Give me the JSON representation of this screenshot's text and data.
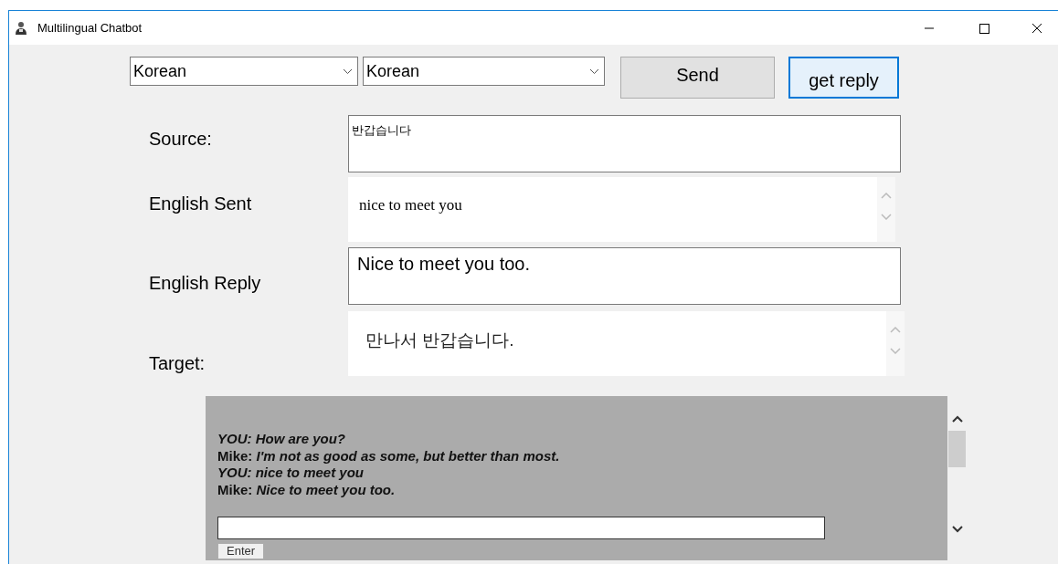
{
  "window": {
    "title": "Multilingual Chatbot"
  },
  "languages": [
    {
      "value": "Korean"
    },
    {
      "value": "Korean"
    }
  ],
  "buttons": [
    {
      "label": "Send",
      "focused": false
    },
    {
      "label": "get reply",
      "focused": true
    }
  ],
  "fields": [
    {
      "label": "Source:",
      "value": "반갑습니다",
      "kind": "box"
    },
    {
      "label": "English Sent",
      "value": "nice to meet you",
      "kind": "scroll"
    },
    {
      "label": "English Reply",
      "value": "Nice to meet you too.",
      "kind": "box"
    },
    {
      "label": "Target:",
      "value": "만나서 반갑습니다.",
      "kind": "scroll"
    }
  ],
  "chat": {
    "lines": [
      {
        "speaker": "YOU:",
        "message": "How are you?",
        "kind": "user"
      },
      {
        "speaker": "Mike:",
        "message": "I'm not as good as some, but better than most.",
        "kind": "bot"
      },
      {
        "speaker": "YOU:",
        "message": "nice to meet you",
        "kind": "user"
      },
      {
        "speaker": "Mike:",
        "message": "Nice to meet you too.",
        "kind": "bot"
      }
    ],
    "button": "Enter"
  }
}
